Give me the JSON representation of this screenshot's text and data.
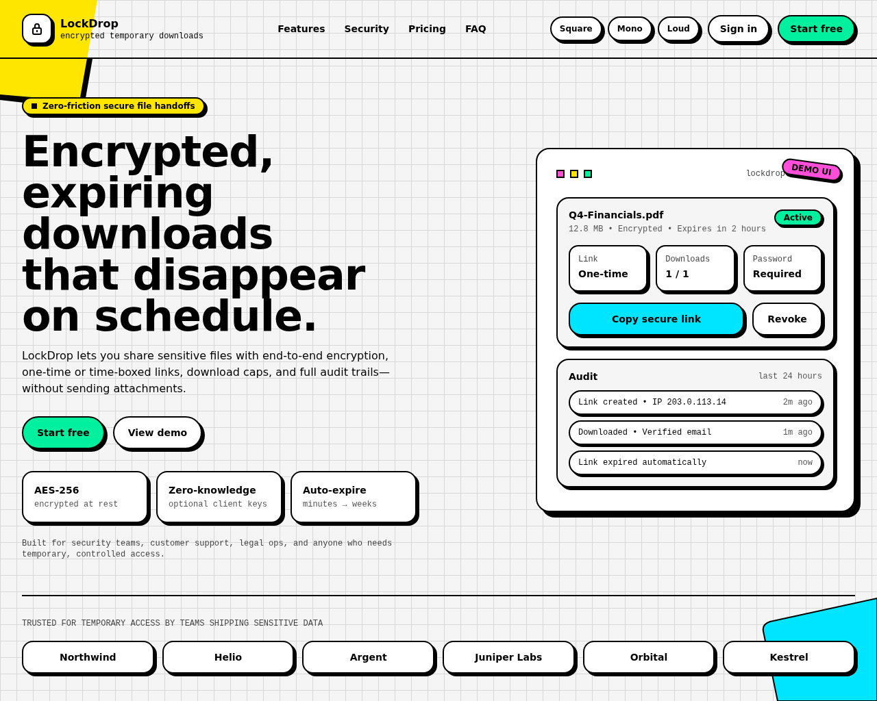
{
  "brand": {
    "name": "LockDrop",
    "tagline": "encrypted temporary downloads"
  },
  "nav": [
    "Features",
    "Security",
    "Pricing",
    "FAQ"
  ],
  "theme_buttons": [
    "Square",
    "Mono",
    "Loud"
  ],
  "header_actions": [
    {
      "label": "Sign in",
      "kind": "secondary"
    },
    {
      "label": "Start free",
      "kind": "primary"
    }
  ],
  "badge": "Zero-friction secure file handoffs",
  "headline": [
    "Encrypted,",
    "expiring",
    "downloads",
    "that disappear",
    "on schedule."
  ],
  "intro": "LockDrop lets you share sensitive files with end-to-end encryption, one-time or time-boxed links, download caps, and full audit trails—without sending attachments.",
  "hero_actions": [
    {
      "label": "Start free",
      "kind": "primary"
    },
    {
      "label": "View demo",
      "kind": "secondary"
    }
  ],
  "stats": [
    {
      "title": "AES-256",
      "detail": "encrypted at rest"
    },
    {
      "title": "Zero-knowledge",
      "detail": "optional client keys"
    },
    {
      "title": "Auto-expire",
      "detail": "minutes → weeks"
    }
  ],
  "footnote": "Built for security teams, customer support, legal ops, and anyone who needs temporary, controlled access.",
  "demo": {
    "window_dots": [
      {
        "color": "#ff4fd8"
      },
      {
        "color": "#ffe600"
      },
      {
        "color": "#00f0a0"
      }
    ],
    "url": "lockdrop",
    "tag": "DEMO UI",
    "file": {
      "name": "Q4-Financials.pdf",
      "meta": "12.8 MB • Encrypted • Expires in 2 hours",
      "status": "Active",
      "fields": [
        {
          "label": "Link",
          "value": "One-time"
        },
        {
          "label": "Downloads",
          "value": "1 / 1"
        },
        {
          "label": "Password",
          "value": "Required"
        }
      ],
      "actions": [
        {
          "label": "Copy secure link",
          "kind": "primary"
        },
        {
          "label": "Revoke",
          "kind": "secondary"
        }
      ]
    },
    "audit": {
      "title": "Audit",
      "range": "last 24 hours",
      "events": [
        {
          "text": "Link created • IP 203.0.113.14",
          "time": "2m ago"
        },
        {
          "text": "Downloaded • Verified email",
          "time": "1m ago"
        },
        {
          "text": "Link expired automatically",
          "time": "now"
        }
      ]
    }
  },
  "trusted": {
    "label": "TRUSTED FOR TEMPORARY ACCESS BY TEAMS SHIPPING SENSITIVE DATA",
    "companies": [
      "Northwind",
      "Helio",
      "Argent",
      "Juniper Labs",
      "Orbital",
      "Kestrel"
    ]
  }
}
